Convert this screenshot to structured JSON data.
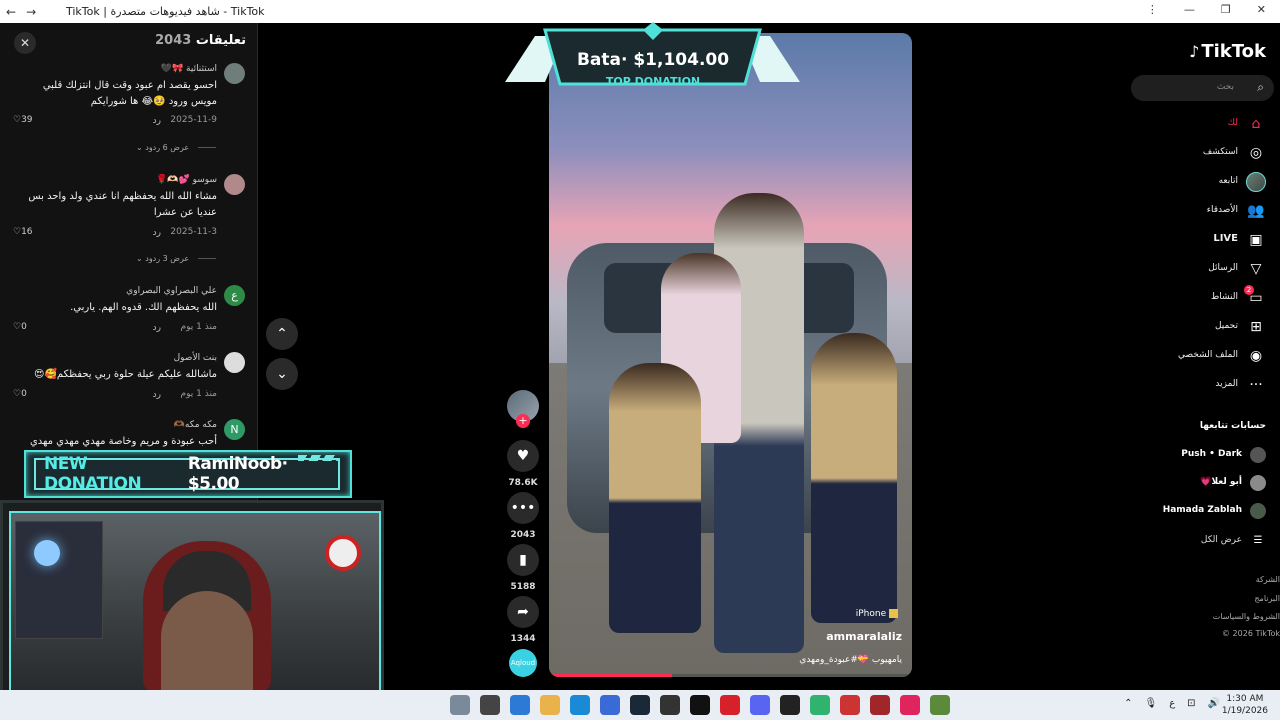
{
  "window": {
    "title": "TikTok | شاهد فيديوهات متصدرة - TikTok",
    "back": "←",
    "forward": "→",
    "reload": "↻",
    "controls": [
      "⋮",
      "—",
      "❐",
      "✕"
    ]
  },
  "comments_panel": {
    "title": "تعليقات",
    "count": "2043",
    "close": "✕",
    "items": [
      {
        "avatar": "",
        "user": "استثنائية 🎀🖤",
        "text": "احسو يقصد ام عبود وقت قال انتزلك قلبي مويس ورود 🥹😂 ها شورايكم",
        "date": "2025-11-9",
        "reply": "رد",
        "likes": "39",
        "view_replies": "عرض 6 ردود"
      },
      {
        "avatar": "",
        "user": "سوسو 💕🫶🏻🌹",
        "text": "مشاء الله الله يحفظهم انا عندي ولد واحد بس عنديا عن عشرا",
        "date": "2025-11-3",
        "reply": "رد",
        "likes": "16",
        "view_replies": "عرض 3 ردود"
      },
      {
        "avatar": "ع",
        "user": "علي البصراوي البصراوي",
        "text": "الله يحفظهم الك. قدوه الهم. ياربي.",
        "date": "منذ 1 يوم",
        "reply": "رد",
        "likes": "0"
      },
      {
        "avatar": "",
        "user": "بنت الأصول",
        "text": "ماشالله عليكم عيلة حلوة ربي يحفظكم🥰😍",
        "date": "منذ 1 يوم",
        "reply": "رد",
        "likes": "0"
      },
      {
        "avatar": "N",
        "user": "مكه مكه🫶🏾",
        "text": "أحب عبودة و مريم وخاصة مهدي مهدي مهدي",
        "date": "",
        "reply": "",
        "likes": ""
      }
    ]
  },
  "scroll": {
    "up": "⌃",
    "down": "⌄"
  },
  "overlay": {
    "new_donation_label": "NEW DONATION",
    "new_donation_value": "RamiNoob· $5.00",
    "top_donation_name": "Bata· $1,104.00",
    "top_donation_label": "TOP DONATION"
  },
  "video": {
    "badge": "iPhone",
    "author": "ammaralaliz",
    "caption": "يامهيوب 💝#عبودة_ومهدي"
  },
  "actions": {
    "plus": "+",
    "like_icon": "heart-icon",
    "likes": "78.6K",
    "comments": "2043",
    "saves": "5188",
    "shares": "1344",
    "sound": "Aqloud"
  },
  "sidebar": {
    "logo": "TikTok",
    "search_placeholder": "بحث",
    "nav": [
      {
        "label": "لك",
        "icon": "home-icon",
        "active": true
      },
      {
        "label": "استكشف",
        "icon": "compass-icon"
      },
      {
        "label": "اتابعه",
        "icon": "avatar-icon"
      },
      {
        "label": "الأصدقاء",
        "icon": "friends-icon"
      },
      {
        "label": "LIVE",
        "icon": "live-icon"
      },
      {
        "label": "الرسائل",
        "icon": "messages-icon"
      },
      {
        "label": "النشاط",
        "icon": "activity-icon",
        "badge": "2"
      },
      {
        "label": "تحميل",
        "icon": "upload-icon"
      },
      {
        "label": "الملف الشخصي",
        "icon": "profile-icon"
      },
      {
        "label": "المزيد",
        "icon": "more-icon"
      }
    ],
    "following_title": "حسابات تتابعها",
    "following": [
      {
        "name": "Push • Dark"
      },
      {
        "name": "أبو لعلا💗"
      },
      {
        "name": "Hamada Zablah"
      }
    ],
    "show_all": "عرض الكل",
    "footer": [
      "الشركة",
      "البرنامج",
      "الشروط والسياسات",
      "© 2026 TikTok"
    ]
  },
  "taskbar": {
    "time": "1:30 AM",
    "date": "1/19/2026",
    "lang": "ع"
  }
}
